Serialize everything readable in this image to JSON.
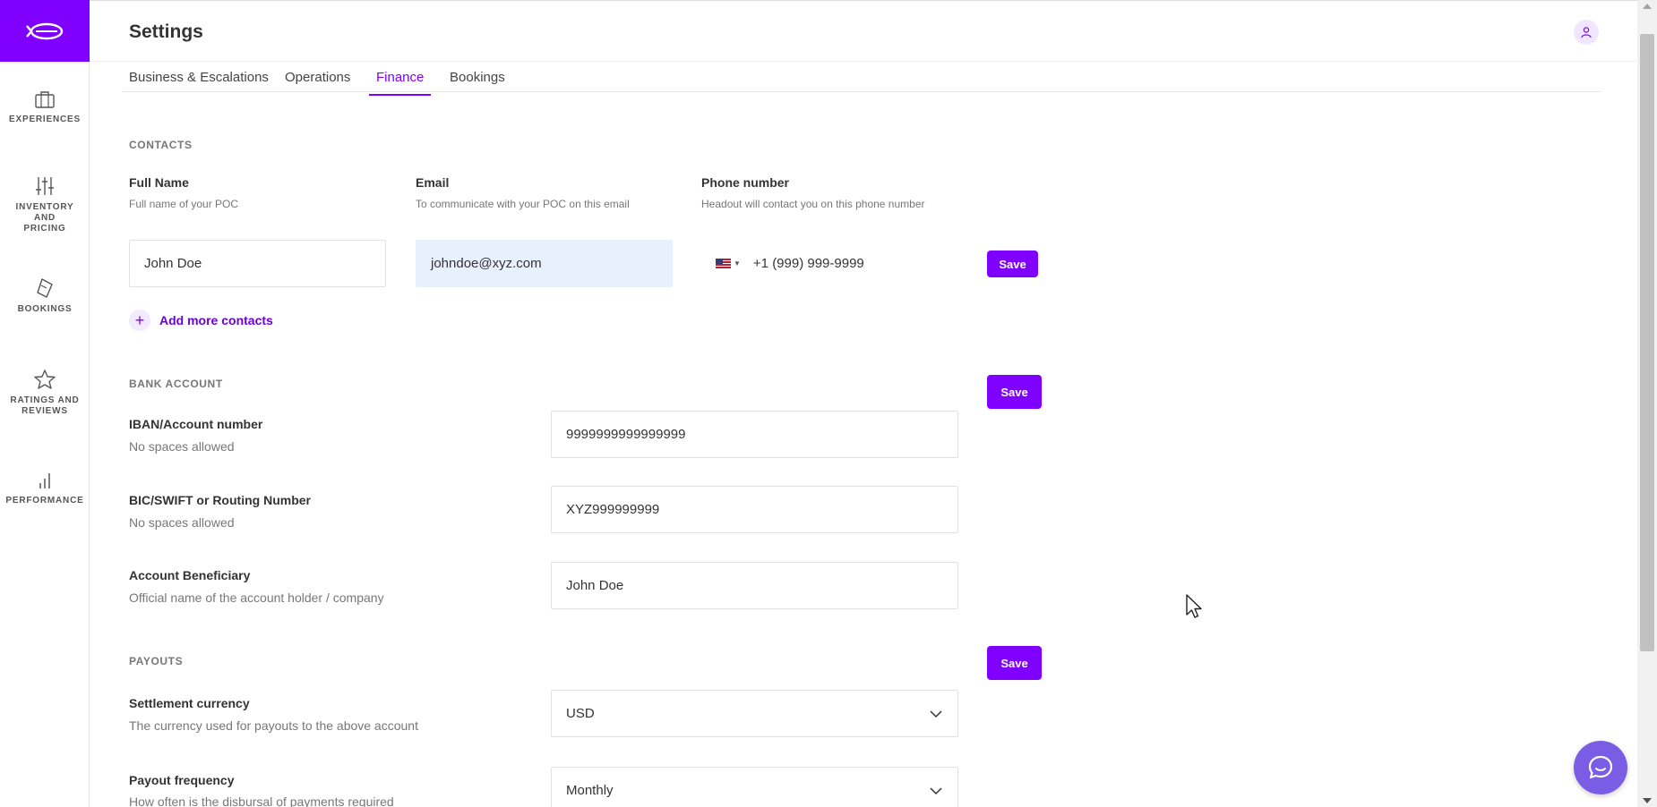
{
  "app": {
    "page_title": "Settings",
    "accent_color": "#8000ff"
  },
  "sidebar": {
    "items": [
      {
        "label": "EXPERIENCES",
        "icon": "briefcase-icon"
      },
      {
        "label": "INVENTORY AND PRICING",
        "icon": "sliders-icon"
      },
      {
        "label": "BOOKINGS",
        "icon": "ticket-icon"
      },
      {
        "label": "RATINGS AND REVIEWS",
        "icon": "star-icon"
      },
      {
        "label": "PERFORMANCE",
        "icon": "bar-chart-icon"
      }
    ]
  },
  "tabs": [
    {
      "label": "Business & Escalations",
      "active": false
    },
    {
      "label": "Operations",
      "active": false
    },
    {
      "label": "Finance",
      "active": true
    },
    {
      "label": "Bookings",
      "active": false
    }
  ],
  "contacts": {
    "heading": "CONTACTS",
    "full_name": {
      "label": "Full Name",
      "sub": "Full name of your POC",
      "value": "John Doe"
    },
    "email": {
      "label": "Email",
      "sub": "To communicate with your POC on this email",
      "value": "johndoe@xyz.com"
    },
    "phone": {
      "label": "Phone number",
      "sub": "Headout will contact you on this phone number",
      "value": "+1 (999) 999-9999",
      "flag": "flag-us-icon"
    },
    "save_label": "Save",
    "add_more_label": "Add more contacts"
  },
  "bank": {
    "heading": "BANK ACCOUNT",
    "save_label": "Save",
    "iban": {
      "label": "IBAN/Account number",
      "sub": "No spaces allowed",
      "value": "9999999999999999"
    },
    "bic": {
      "label": "BIC/SWIFT or Routing Number",
      "sub": "No spaces allowed",
      "value": "XYZ999999999"
    },
    "beneficiary": {
      "label": "Account Beneficiary",
      "sub": "Official name of the account holder / company",
      "value": "John Doe"
    }
  },
  "payouts": {
    "heading": "PAYOUTS",
    "save_label": "Save",
    "currency": {
      "label": "Settlement currency",
      "sub": "The currency used for payouts to the above account",
      "value": "USD"
    },
    "frequency": {
      "label": "Payout frequency",
      "sub": "How often is the disbursal of payments required",
      "value": "Monthly"
    }
  }
}
